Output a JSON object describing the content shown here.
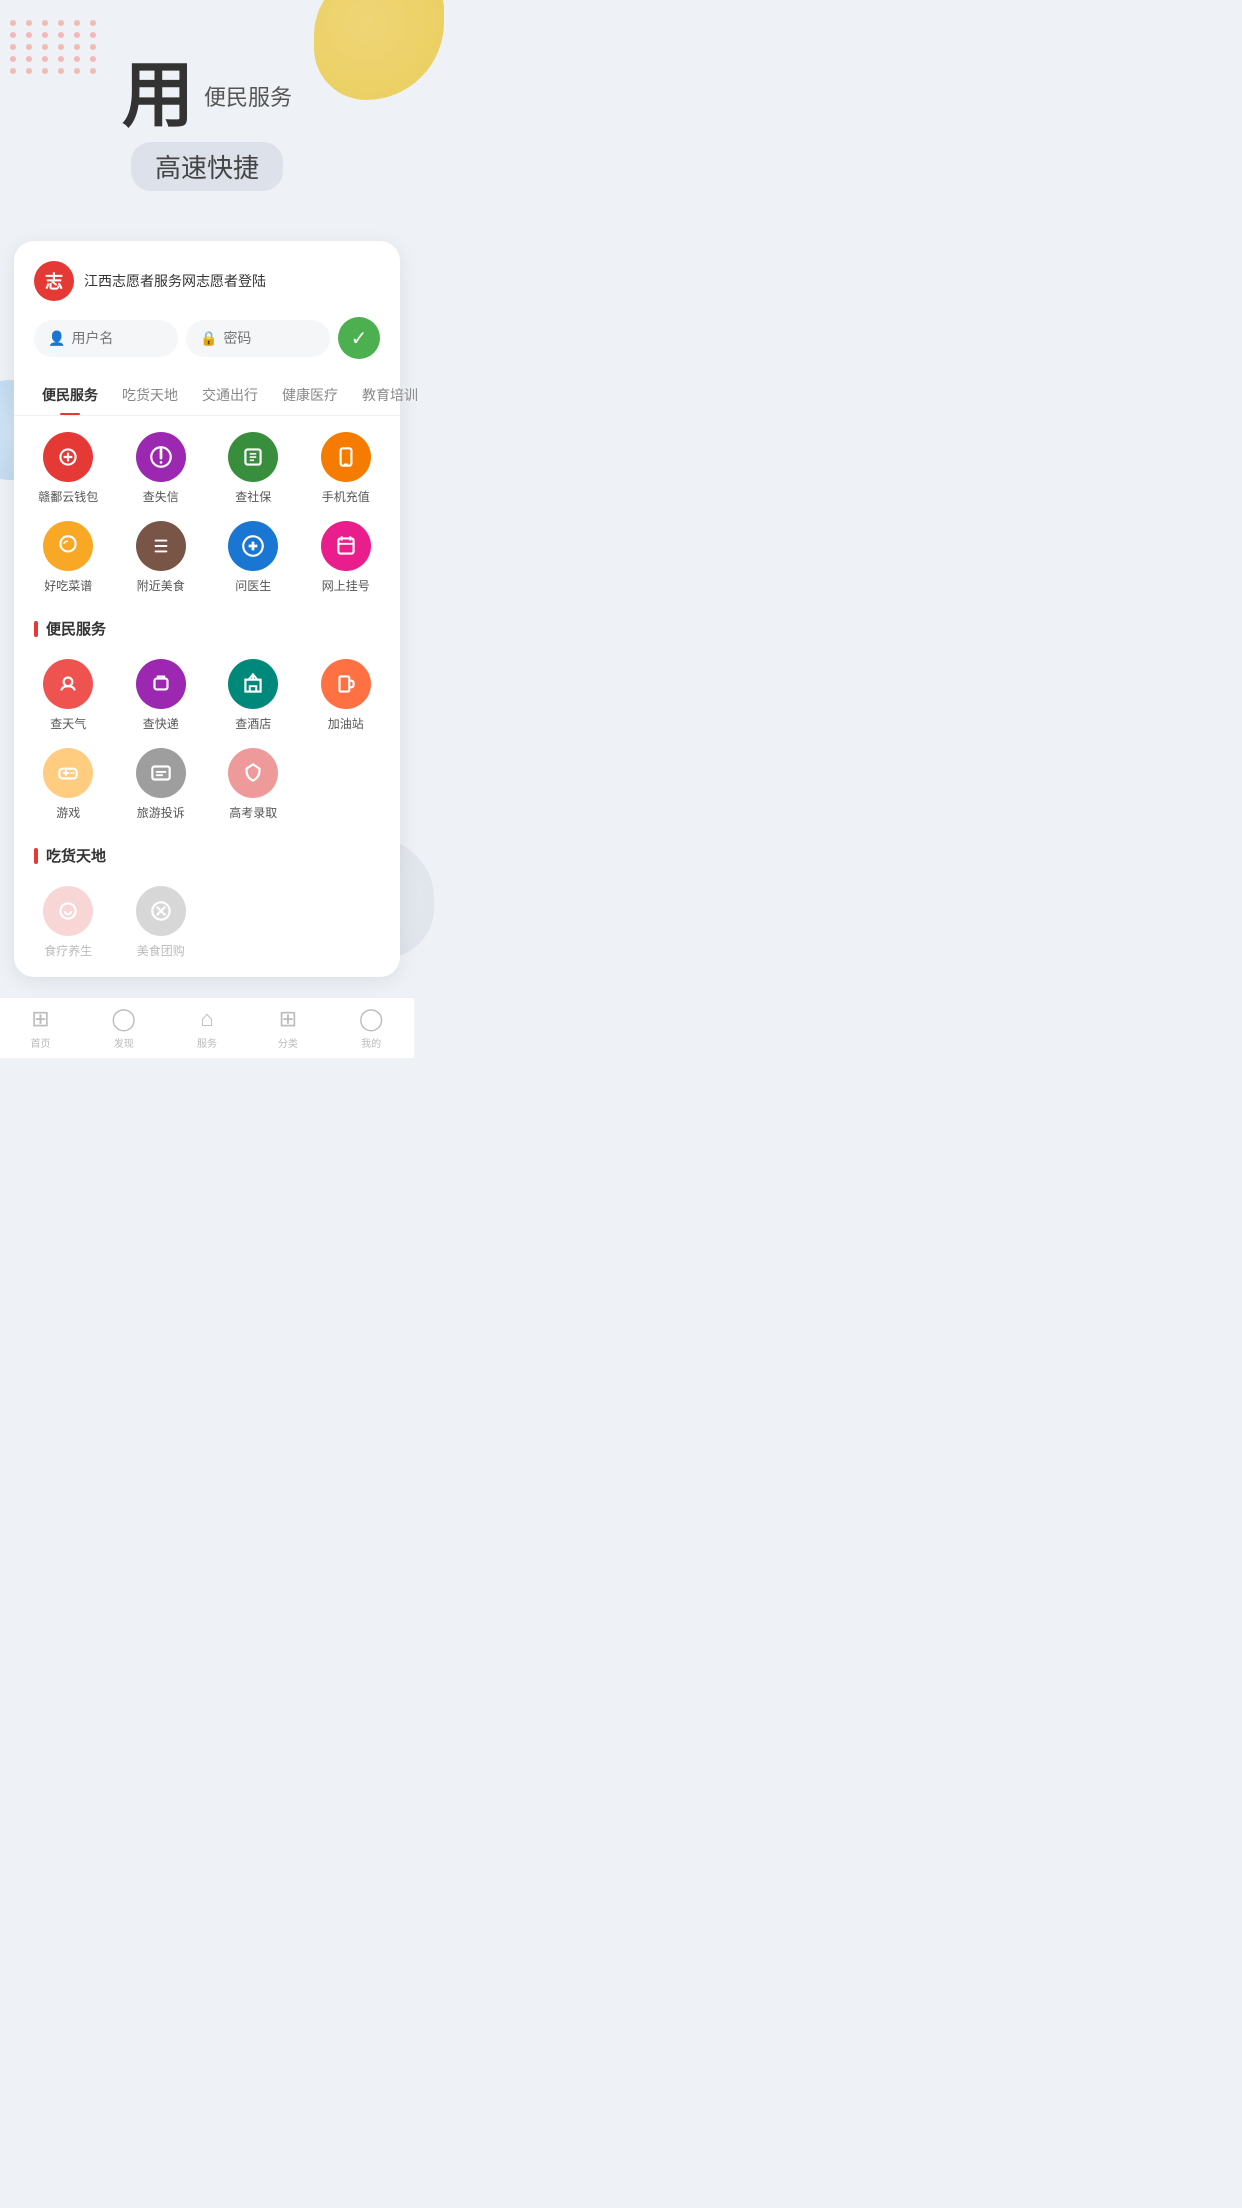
{
  "hero": {
    "char": "用",
    "subtitle": "便民服务",
    "tagline": "高速快捷"
  },
  "login": {
    "logo_text": "志",
    "title": "江西志愿者服务网志愿者登陆",
    "username_placeholder": "用户名",
    "password_placeholder": "密码"
  },
  "tabs": [
    {
      "label": "便民服务",
      "active": true
    },
    {
      "label": "吃货天地",
      "active": false
    },
    {
      "label": "交通出行",
      "active": false
    },
    {
      "label": "健康医疗",
      "active": false
    },
    {
      "label": "教育培训",
      "active": false
    }
  ],
  "service_grid_1": [
    {
      "label": "赣鄱云钱包",
      "icon": "💰",
      "color": "ic-red"
    },
    {
      "label": "查失信",
      "icon": "⚠",
      "color": "ic-purple"
    },
    {
      "label": "查社保",
      "icon": "🏠",
      "color": "ic-green"
    },
    {
      "label": "手机充值",
      "icon": "📱",
      "color": "ic-orange"
    },
    {
      "label": "好吃菜谱",
      "icon": "🍜",
      "color": "ic-yellow"
    },
    {
      "label": "附近美食",
      "icon": "🍹",
      "color": "ic-brown"
    },
    {
      "label": "问医生",
      "icon": "➕",
      "color": "ic-blue"
    },
    {
      "label": "网上挂号",
      "icon": "🖥",
      "color": "ic-pink"
    }
  ],
  "section_biminservice": {
    "title": "便民服务"
  },
  "service_grid_2": [
    {
      "label": "查天气",
      "icon": "☁",
      "color": "ic-salmon"
    },
    {
      "label": "查快递",
      "icon": "📦",
      "color": "ic-purple"
    },
    {
      "label": "查酒店",
      "icon": "🏢",
      "color": "ic-teal"
    },
    {
      "label": "加油站",
      "icon": "⛽",
      "color": "ic-coral"
    },
    {
      "label": "游戏",
      "icon": "🎮",
      "color": "ic-light-orange"
    },
    {
      "label": "旅游投诉",
      "icon": "✉",
      "color": "ic-gray"
    },
    {
      "label": "高考录取",
      "icon": "✏",
      "color": "ic-light-red"
    }
  ],
  "section_chihuo": {
    "title": "吃货天地"
  },
  "service_grid_3": [
    {
      "label": "食疗养生",
      "icon": "🌿",
      "color": "ic-light-red"
    },
    {
      "label": "美食团购",
      "icon": "✕",
      "color": "ic-gray"
    }
  ],
  "bottom_nav": [
    {
      "label": "首页",
      "icon": "⊞"
    },
    {
      "label": "发现",
      "icon": "◯"
    },
    {
      "label": "服务",
      "icon": "⌂"
    },
    {
      "label": "分类",
      "icon": "⊞"
    },
    {
      "label": "我的",
      "icon": "◯"
    }
  ]
}
